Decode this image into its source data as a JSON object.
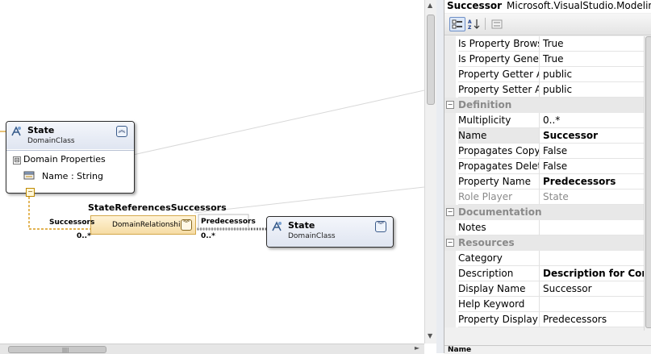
{
  "diagram": {
    "state_left": {
      "title": "State",
      "subtitle": "DomainClass",
      "collapse_icon": "double-chevron-up",
      "compartment_title": "Domain Properties",
      "compartment_toggle": "⊟",
      "property": "Name : String"
    },
    "state_right": {
      "title": "State",
      "subtitle": "DomainClass",
      "collapse_icon": "double-chevron-down"
    },
    "relationship": {
      "name": "StateReferencesSuccessors",
      "label": "DomainRelationship",
      "source_role": "Successors",
      "source_multiplicity": "0..*",
      "target_role": "Predecessors",
      "target_multiplicity": "0..*"
    }
  },
  "properties": {
    "selected_name": "Successor",
    "selected_type": "Microsoft.VisualStudio.Modeling.",
    "toolbar": {
      "categorized_icon": "categorized-icon",
      "alphabetical_icon": "alphabetical-sort-icon",
      "property_pages_icon": "property-pages-icon"
    },
    "rows": [
      {
        "name": "Is Property Browsa",
        "value": "True"
      },
      {
        "name": "Is Property Generat",
        "value": "True"
      },
      {
        "name": "Property Getter Ac",
        "value": "public"
      },
      {
        "name": "Property Setter Acc",
        "value": "public"
      },
      {
        "category": "Definition"
      },
      {
        "name": "Multiplicity",
        "value": "0..*"
      },
      {
        "name": "Name",
        "value": "Successor",
        "bold": true,
        "selected": true
      },
      {
        "name": "Propagates Copy",
        "value": "False"
      },
      {
        "name": "Propagates Delete",
        "value": "False"
      },
      {
        "name": "Property Name",
        "value": "Predecessors",
        "bold": true
      },
      {
        "name": "Role Player",
        "value": "State",
        "disabled": true
      },
      {
        "category": "Documentation"
      },
      {
        "name": "Notes",
        "value": ""
      },
      {
        "category": "Resources"
      },
      {
        "name": "Category",
        "value": ""
      },
      {
        "name": "Description",
        "value": "Description for Comp",
        "bold": true
      },
      {
        "name": "Display Name",
        "value": "Successor"
      },
      {
        "name": "Help Keyword",
        "value": ""
      },
      {
        "name": "Property Display N",
        "value": "Predecessors"
      }
    ],
    "description_pane_title": "Name"
  },
  "colors": {
    "shape_header": "#dfe5f1",
    "relationship_fill": "#f6dca4",
    "connector_orange": "#d99a1a",
    "category_row": "#e8e8e8"
  }
}
